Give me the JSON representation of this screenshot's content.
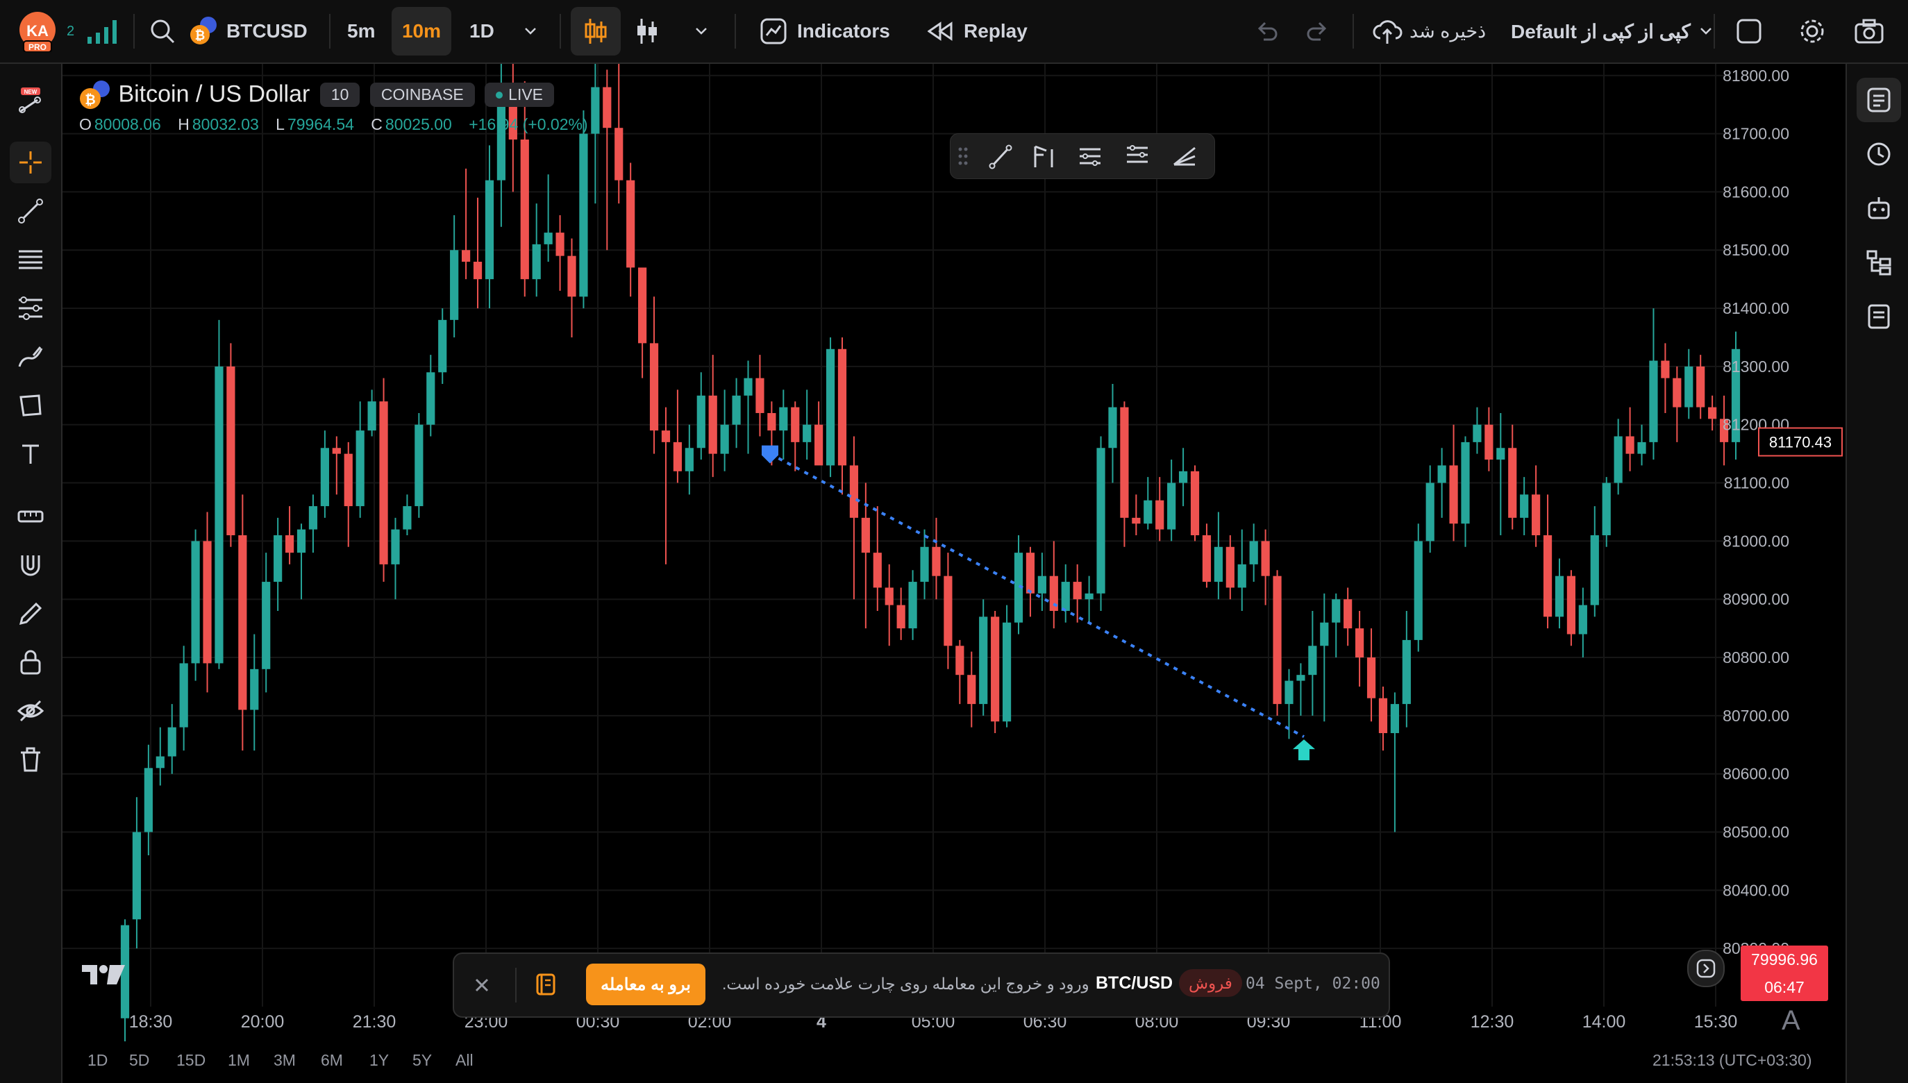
{
  "colors": {
    "up": "#26a69a",
    "down": "#ef5350",
    "accent": "#f7931a",
    "line": "#3b82f6"
  },
  "header": {
    "avatar_initials": "KA",
    "avatar_badge": "PRO",
    "notifications": "2",
    "symbol": "BTCUSD",
    "intervals": [
      "5m",
      "10m",
      "1D"
    ],
    "active_interval": "10m",
    "indicators_label": "Indicators",
    "replay_label": "Replay",
    "saved_label": "ذخیره شد",
    "layout_label": "Default کپی از کپی از"
  },
  "legend": {
    "title": "Bitcoin / US Dollar",
    "interval": "10",
    "exchange": "COINBASE",
    "status": "LIVE",
    "o_label": "O",
    "o": "80008.06",
    "h_label": "H",
    "h": "80032.03",
    "l_label": "L",
    "l": "79964.54",
    "c_label": "C",
    "c": "80025.00",
    "change": "+16.94 (+0.02%)"
  },
  "axis": {
    "price_ticks": [
      "81800.00",
      "81700.00",
      "81600.00",
      "81500.00",
      "81400.00",
      "81300.00",
      "81200.00",
      "81100.00",
      "81000.00",
      "80900.00",
      "80800.00",
      "80700.00",
      "80600.00",
      "80500.00",
      "80400.00",
      "80300.00"
    ],
    "time_ticks": [
      "18:30",
      "20:00",
      "21:30",
      "23:00",
      "00:30",
      "02:00",
      "4",
      "05:00",
      "06:30",
      "08:00",
      "09:30",
      "11:00",
      "12:30",
      "14:00",
      "15:30"
    ],
    "crosshair_price": "81170.43",
    "last_price": "79996.96",
    "countdown": "06:47"
  },
  "notice": {
    "timestamp": "04 Sept, 02:00",
    "side": "فروش",
    "pair": "BTC/USD",
    "message": "ورود و خروج این معامله روی چارت علامت خورده است.",
    "button": "برو به معامله"
  },
  "footer": {
    "ranges": [
      "1D",
      "5D",
      "15D",
      "1M",
      "3M",
      "6M",
      "1Y",
      "5Y",
      "All"
    ],
    "clock": "21:53:13 (UTC+03:30)"
  },
  "chart_data": {
    "type": "candlestick",
    "title": "Bitcoin / US Dollar",
    "interval": "10m",
    "y_range": [
      80200,
      81820
    ],
    "x_ticks": [
      "18:30",
      "20:00",
      "21:30",
      "23:00",
      "00:30",
      "02:00",
      "4",
      "05:00",
      "06:30",
      "08:00",
      "09:30",
      "11:00",
      "12:30",
      "14:00",
      "15:30"
    ],
    "candles_ohlc": [
      [
        80180,
        80350,
        80140,
        80340
      ],
      [
        80350,
        80560,
        80300,
        80500
      ],
      [
        80500,
        80650,
        80460,
        80610
      ],
      [
        80610,
        80680,
        80580,
        80630
      ],
      [
        80630,
        80720,
        80600,
        80680
      ],
      [
        80680,
        80820,
        80640,
        80790
      ],
      [
        80790,
        81020,
        80760,
        81000
      ],
      [
        81000,
        81050,
        80740,
        80790
      ],
      [
        80790,
        81380,
        80780,
        81300
      ],
      [
        81300,
        81340,
        80990,
        81010
      ],
      [
        81010,
        81080,
        80640,
        80710
      ],
      [
        80710,
        80840,
        80640,
        80780
      ],
      [
        80780,
        80980,
        80740,
        80930
      ],
      [
        80930,
        81040,
        80880,
        81010
      ],
      [
        81010,
        81060,
        80960,
        80980
      ],
      [
        80980,
        81030,
        80900,
        81020
      ],
      [
        81020,
        81080,
        80980,
        81060
      ],
      [
        81060,
        81190,
        81040,
        81160
      ],
      [
        81160,
        81180,
        81080,
        81150
      ],
      [
        81150,
        81170,
        80990,
        81060
      ],
      [
        81060,
        81240,
        81040,
        81190
      ],
      [
        81190,
        81260,
        81180,
        81240
      ],
      [
        81240,
        81280,
        80930,
        80960
      ],
      [
        80960,
        81040,
        80900,
        81020
      ],
      [
        81020,
        81080,
        81010,
        81060
      ],
      [
        81060,
        81220,
        81040,
        81200
      ],
      [
        81200,
        81320,
        81180,
        81290
      ],
      [
        81290,
        81400,
        81270,
        81380
      ],
      [
        81380,
        81560,
        81350,
        81500
      ],
      [
        81500,
        81640,
        81450,
        81480
      ],
      [
        81480,
        81590,
        81400,
        81450
      ],
      [
        81450,
        81680,
        81400,
        81620
      ],
      [
        81620,
        81820,
        81540,
        81750
      ],
      [
        81750,
        81860,
        81600,
        81690
      ],
      [
        81690,
        81790,
        81420,
        81450
      ],
      [
        81450,
        81580,
        81420,
        81510
      ],
      [
        81510,
        81630,
        81480,
        81530
      ],
      [
        81530,
        81560,
        81430,
        81490
      ],
      [
        81490,
        81520,
        81350,
        81420
      ],
      [
        81420,
        81740,
        81400,
        81700
      ],
      [
        81700,
        81830,
        81580,
        81780
      ],
      [
        81780,
        81810,
        81500,
        81710
      ],
      [
        81710,
        81830,
        81580,
        81620
      ],
      [
        81620,
        81650,
        81420,
        81470
      ],
      [
        81470,
        81400,
        81280,
        81340
      ],
      [
        81340,
        81420,
        81150,
        81190
      ],
      [
        81190,
        81230,
        80960,
        81170
      ],
      [
        81170,
        81260,
        81100,
        81120
      ],
      [
        81120,
        81200,
        81080,
        81160
      ],
      [
        81160,
        81290,
        81140,
        81250
      ],
      [
        81250,
        81320,
        81110,
        81150
      ],
      [
        81150,
        81260,
        81120,
        81200
      ],
      [
        81200,
        81280,
        81160,
        81250
      ],
      [
        81250,
        81310,
        81150,
        81280
      ],
      [
        81280,
        81320,
        81180,
        81220
      ],
      [
        81220,
        81240,
        81130,
        81190
      ],
      [
        81190,
        81260,
        81140,
        81230
      ],
      [
        81230,
        81240,
        81120,
        81170
      ],
      [
        81170,
        81260,
        81140,
        81200
      ],
      [
        81200,
        81240,
        81150,
        81130
      ],
      [
        81130,
        81350,
        81110,
        81330
      ],
      [
        81330,
        81350,
        81080,
        81130
      ],
      [
        81130,
        81180,
        80900,
        81040
      ],
      [
        81040,
        81100,
        80850,
        80980
      ],
      [
        80980,
        81060,
        80880,
        80920
      ],
      [
        80920,
        80960,
        80820,
        80890
      ],
      [
        80890,
        80920,
        80830,
        80850
      ],
      [
        80850,
        80950,
        80830,
        80930
      ],
      [
        80930,
        81020,
        80900,
        80990
      ],
      [
        80990,
        81040,
        80900,
        80940
      ],
      [
        80940,
        80980,
        80780,
        80820
      ],
      [
        80820,
        80830,
        80720,
        80770
      ],
      [
        80770,
        80810,
        80680,
        80720
      ],
      [
        80720,
        80900,
        80700,
        80870
      ],
      [
        80870,
        80880,
        80670,
        80690
      ],
      [
        80690,
        80890,
        80680,
        80860
      ],
      [
        80860,
        81010,
        80840,
        80980
      ],
      [
        80980,
        80990,
        80870,
        80910
      ],
      [
        80910,
        80980,
        80880,
        80940
      ],
      [
        80940,
        81000,
        80850,
        80880
      ],
      [
        80880,
        80960,
        80860,
        80930
      ],
      [
        80930,
        80960,
        80860,
        80900
      ],
      [
        80900,
        80940,
        80860,
        80910
      ],
      [
        80910,
        81180,
        80880,
        81160
      ],
      [
        81160,
        81270,
        81100,
        81230
      ],
      [
        81230,
        81240,
        80990,
        81040
      ],
      [
        81040,
        81080,
        81010,
        81030
      ],
      [
        81030,
        81110,
        81020,
        81070
      ],
      [
        81070,
        81110,
        81000,
        81020
      ],
      [
        81020,
        81140,
        81000,
        81100
      ],
      [
        81100,
        81160,
        81060,
        81120
      ],
      [
        81120,
        81130,
        81000,
        81010
      ],
      [
        81010,
        81030,
        80920,
        80930
      ],
      [
        80930,
        81050,
        80900,
        80990
      ],
      [
        80990,
        81010,
        80900,
        80920
      ],
      [
        80920,
        81020,
        80880,
        80960
      ],
      [
        80960,
        81030,
        80930,
        81000
      ],
      [
        81000,
        81020,
        80890,
        80940
      ],
      [
        80940,
        80950,
        80700,
        80720
      ],
      [
        80720,
        80780,
        80660,
        80760
      ],
      [
        80760,
        80790,
        80700,
        80770
      ],
      [
        80770,
        80880,
        80700,
        80820
      ],
      [
        80820,
        80910,
        80690,
        80860
      ],
      [
        80860,
        80910,
        80800,
        80900
      ],
      [
        80900,
        80920,
        80820,
        80850
      ],
      [
        80850,
        80880,
        80750,
        80800
      ],
      [
        80800,
        80850,
        80690,
        80730
      ],
      [
        80730,
        80750,
        80640,
        80670
      ],
      [
        80670,
        80740,
        80500,
        80720
      ],
      [
        80720,
        80880,
        80680,
        80830
      ],
      [
        80830,
        81030,
        80810,
        81000
      ],
      [
        81000,
        81130,
        80980,
        81100
      ],
      [
        81100,
        81160,
        81040,
        81130
      ],
      [
        81130,
        81200,
        81000,
        81030
      ],
      [
        81030,
        81180,
        80990,
        81170
      ],
      [
        81170,
        81230,
        81150,
        81200
      ],
      [
        81200,
        81230,
        81120,
        81140
      ],
      [
        81140,
        81220,
        81010,
        81160
      ],
      [
        81160,
        81200,
        81020,
        81040
      ],
      [
        81040,
        81110,
        81010,
        81080
      ],
      [
        81080,
        81130,
        80990,
        81010
      ],
      [
        81010,
        81080,
        80850,
        80870
      ],
      [
        80870,
        80970,
        80850,
        80940
      ],
      [
        80940,
        80950,
        80820,
        80840
      ],
      [
        80840,
        80920,
        80800,
        80890
      ],
      [
        80890,
        81060,
        80870,
        81010
      ],
      [
        81010,
        81110,
        80990,
        81100
      ],
      [
        81100,
        81210,
        81080,
        81180
      ],
      [
        81180,
        81230,
        81120,
        81150
      ],
      [
        81150,
        81200,
        81130,
        81170
      ],
      [
        81170,
        81400,
        81140,
        81310
      ],
      [
        81310,
        81340,
        81220,
        81280
      ],
      [
        81280,
        81300,
        81170,
        81230
      ],
      [
        81230,
        81330,
        81210,
        81300
      ],
      [
        81300,
        81320,
        81210,
        81230
      ],
      [
        81230,
        81250,
        81190,
        81210
      ],
      [
        81210,
        81250,
        81130,
        81170
      ],
      [
        81170,
        81360,
        81140,
        81330
      ]
    ],
    "trade_line": {
      "entry": {
        "time": "02:00",
        "price": 81150,
        "side": "sell"
      },
      "exit": {
        "price": 80640
      }
    }
  }
}
